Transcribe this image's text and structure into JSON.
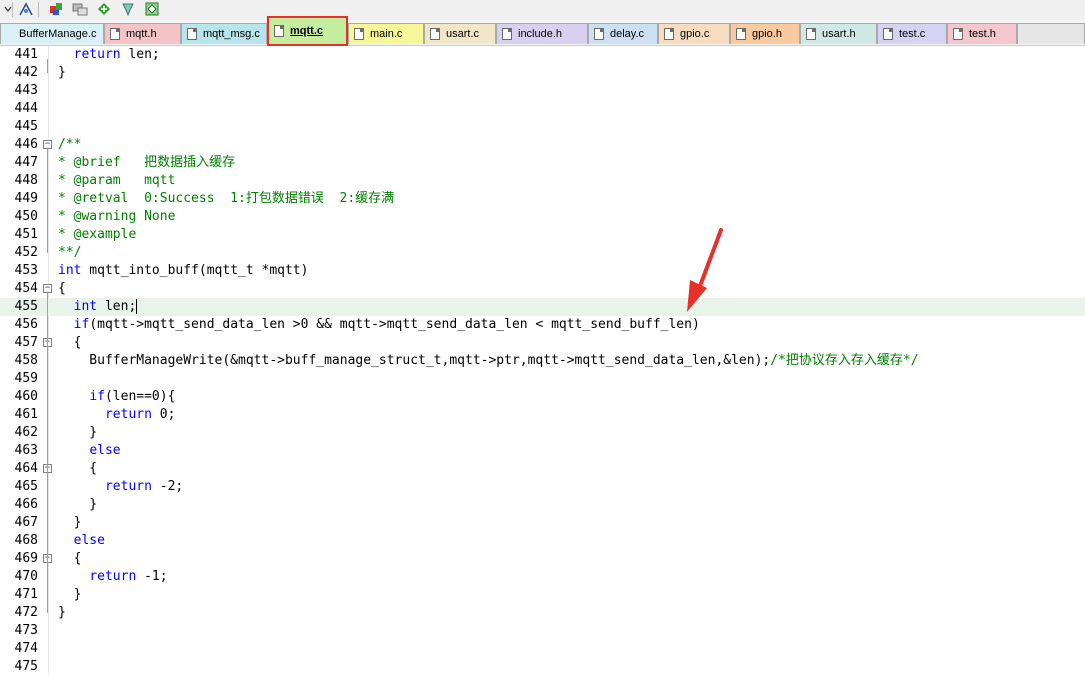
{
  "toolbar": {
    "icons": [
      "build-icon",
      "download-icon",
      "options-icon",
      "insert-icon",
      "debug-icon",
      "settings-icon"
    ]
  },
  "tabs": [
    {
      "label": "BufferManage.c",
      "color": "#d8f0f6"
    },
    {
      "label": "mqtt.h",
      "color": "#f3c3c6"
    },
    {
      "label": "mqtt_msg.c",
      "color": "#b8e4ec"
    },
    {
      "label": "mqtt.c",
      "color": "#c4ee9e",
      "active": true
    },
    {
      "label": "main.c",
      "color": "#f7f797"
    },
    {
      "label": "usart.c",
      "color": "#f1e6c8"
    },
    {
      "label": "include.h",
      "color": "#d8d0ef"
    },
    {
      "label": "delay.c",
      "color": "#cde0f2"
    },
    {
      "label": "gpio.c",
      "color": "#f6ddc0"
    },
    {
      "label": "gpio.h",
      "color": "#f9c9a0"
    },
    {
      "label": "usart.h",
      "color": "#cfe8e6"
    },
    {
      "label": "test.c",
      "color": "#d5d2f2"
    },
    {
      "label": "test.h",
      "color": "#f3c7cd"
    }
  ],
  "editor": {
    "current_line": 455,
    "lines": [
      {
        "n": "441",
        "code": "  return len;"
      },
      {
        "n": "442",
        "code": "}"
      },
      {
        "n": "443",
        "code": ""
      },
      {
        "n": "444",
        "code": ""
      },
      {
        "n": "445",
        "code": ""
      },
      {
        "n": "446",
        "code": "/**"
      },
      {
        "n": "447",
        "code": "* @brief   把数据插入缓存"
      },
      {
        "n": "448",
        "code": "* @param   mqtt"
      },
      {
        "n": "449",
        "code": "* @retval  0:Success  1:打包数据错误  2:缓存满"
      },
      {
        "n": "450",
        "code": "* @warning None"
      },
      {
        "n": "451",
        "code": "* @example"
      },
      {
        "n": "452",
        "code": "**/"
      },
      {
        "n": "453",
        "code": "int mqtt_into_buff(mqtt_t *mqtt)"
      },
      {
        "n": "454",
        "code": "{"
      },
      {
        "n": "455",
        "code": "  int len;"
      },
      {
        "n": "456",
        "code": "  if(mqtt->mqtt_send_data_len >0 && mqtt->mqtt_send_data_len < mqtt_send_buff_len)"
      },
      {
        "n": "457",
        "code": "  {"
      },
      {
        "n": "458",
        "code": "    BufferManageWrite(&mqtt->buff_manage_struct_t,mqtt->ptr,mqtt->mqtt_send_data_len,&len);/*把协议存入存入缓存*/"
      },
      {
        "n": "459",
        "code": ""
      },
      {
        "n": "460",
        "code": "    if(len==0){"
      },
      {
        "n": "461",
        "code": "      return 0;"
      },
      {
        "n": "462",
        "code": "    }"
      },
      {
        "n": "463",
        "code": "    else"
      },
      {
        "n": "464",
        "code": "    {"
      },
      {
        "n": "465",
        "code": "      return -2;"
      },
      {
        "n": "466",
        "code": "    }"
      },
      {
        "n": "467",
        "code": "  }"
      },
      {
        "n": "468",
        "code": "  else"
      },
      {
        "n": "469",
        "code": "  {"
      },
      {
        "n": "470",
        "code": "    return -1;"
      },
      {
        "n": "471",
        "code": "  }"
      },
      {
        "n": "472",
        "code": "}"
      },
      {
        "n": "473",
        "code": ""
      },
      {
        "n": "474",
        "code": ""
      },
      {
        "n": "475",
        "code": ""
      }
    ]
  },
  "annotation": {
    "color": "#e8302a"
  }
}
